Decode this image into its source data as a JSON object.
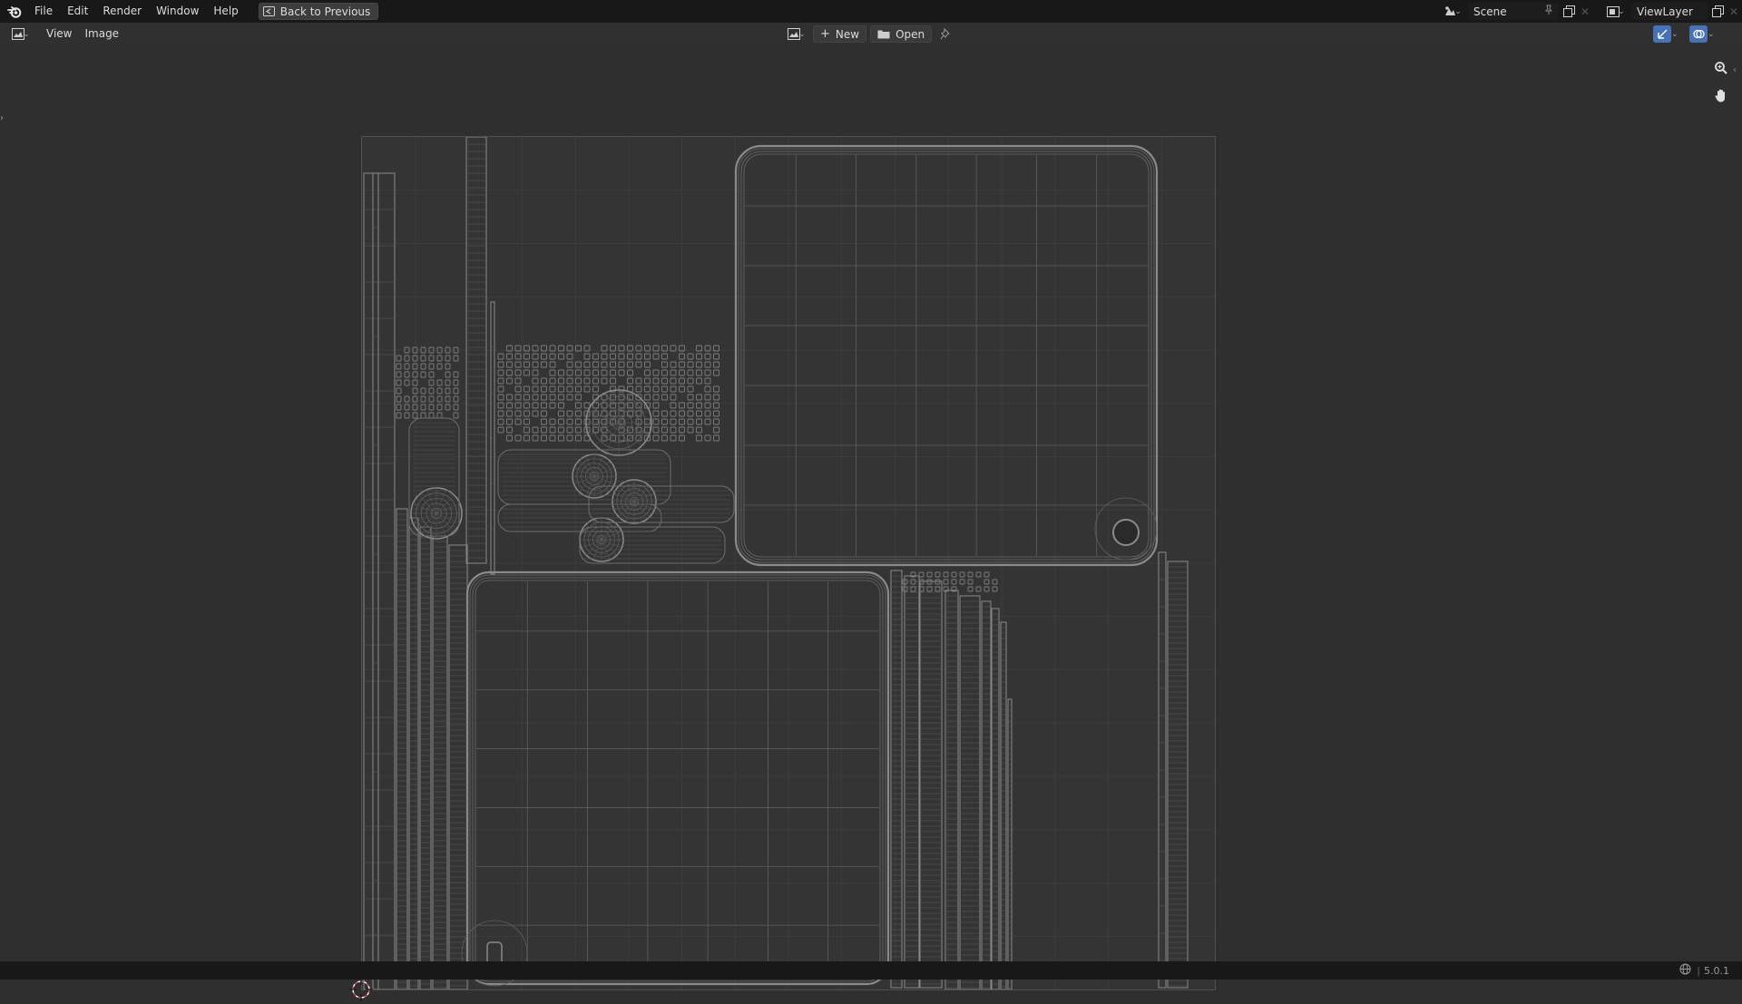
{
  "topbar": {
    "menus": [
      "File",
      "Edit",
      "Render",
      "Window",
      "Help"
    ],
    "back_label": "Back to Previous",
    "scene_name": "Scene",
    "view_layer": "ViewLayer"
  },
  "header": {
    "menus": [
      "View",
      "Image"
    ],
    "new_label": "New",
    "open_label": "Open"
  },
  "status": {
    "version": "5.0.1"
  },
  "icons": {
    "blender_logo": "blender-logo-icon",
    "editor_type": "image-editor-icon",
    "zoom": "zoom-icon",
    "pan": "hand-icon",
    "pin": "pin-icon",
    "network": "network-icon"
  },
  "colors": {
    "background": "#2f2f2f",
    "topbar": "#181818",
    "uv_wire": "#8a8a8a",
    "accent_blue": "#4772b3"
  }
}
